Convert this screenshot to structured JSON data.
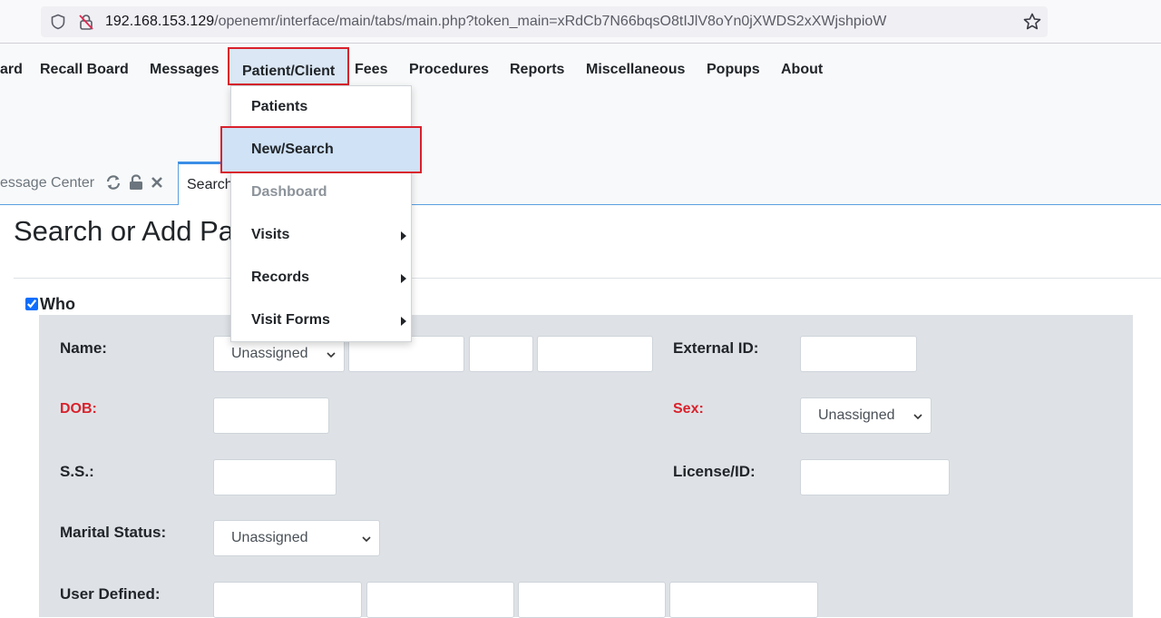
{
  "browser": {
    "url_host": "192.168.153.129",
    "url_path": "/openemr/interface/main/tabs/main.php?token_main=xRdCb7N66bqsO8tIJlV8oYn0jXWDS2xXWjshpioW"
  },
  "nav": {
    "items": [
      "ard",
      "Recall Board",
      "Messages",
      "Patient/Client",
      "Fees",
      "Procedures",
      "Reports",
      "Miscellaneous",
      "Popups",
      "About"
    ]
  },
  "tabs": {
    "tab1": "essage Center",
    "tab2": "Search"
  },
  "page": {
    "title": "Search or Add Pa",
    "who_label": "Who"
  },
  "form": {
    "name_label": "Name:",
    "name_title_value": "Unassigned",
    "external_id_label": "External ID:",
    "dob_label": "DOB:",
    "sex_label": "Sex:",
    "sex_value": "Unassigned",
    "ss_label": "S.S.:",
    "license_label": "License/ID:",
    "marital_label": "Marital Status:",
    "marital_value": "Unassigned",
    "user_defined_label": "User Defined:"
  },
  "dropdown": {
    "items": [
      "Patients",
      "New/Search",
      "Dashboard",
      "Visits",
      "Records",
      "Visit Forms"
    ]
  },
  "colors": {
    "highlight_border": "#d9212c",
    "active_bg": "#dbe7f4",
    "panel_bg": "#dee2e6",
    "required_label": "#d9212c"
  }
}
